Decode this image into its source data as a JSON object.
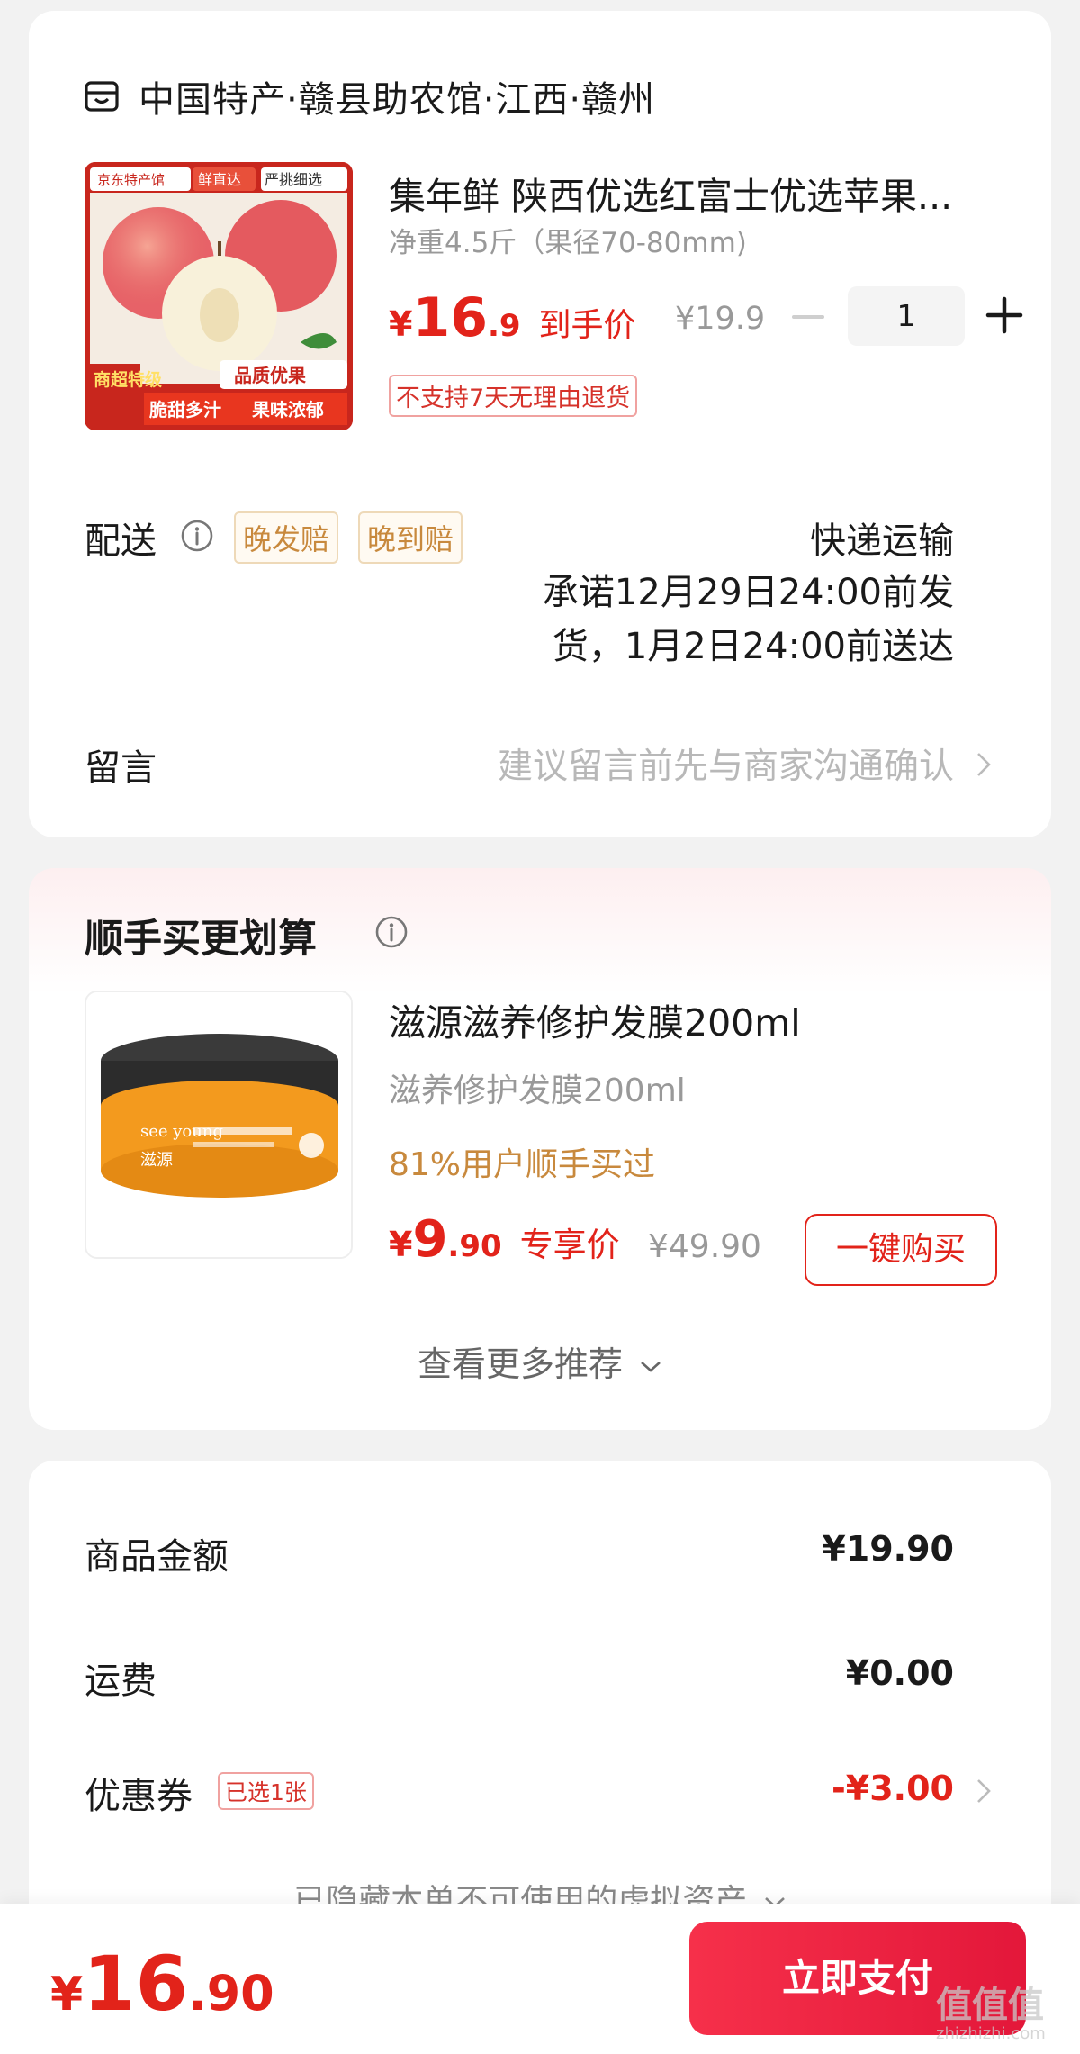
{
  "store": {
    "name": "中国特产·赣县助农馆·江西·赣州",
    "icon": "store-icon"
  },
  "product": {
    "title": "集年鲜 陕西优选红富士优选苹果...",
    "spec": "净重4.5斤（果径70-80mm)",
    "price_currency": "¥",
    "price_int": "16",
    "price_dec": ".9",
    "price_tag": "到手价",
    "orig_price": "¥19.9",
    "quantity": "1",
    "return_policy": "不支持7天无理由退货",
    "image_labels": {
      "brand": "京东特产馆",
      "fresh": "鲜直达",
      "select": "严挑细选",
      "grade": "商超特级",
      "quality": "品质优果",
      "taste1": "脆甜多汁",
      "taste2": "果味浓郁"
    }
  },
  "delivery": {
    "label": "配送",
    "tags": [
      "晚发赔",
      "晚到赔"
    ],
    "method": "快递运输",
    "promise": "承诺12月29日24:00前发货，1月2日24:00前送达"
  },
  "message": {
    "label": "留言",
    "placeholder": "建议留言前先与商家沟通确认"
  },
  "recommend": {
    "title": "顺手买更划算",
    "item": {
      "name": "滋源滋养修护发膜200ml",
      "spec": "滋养修护发膜200ml",
      "bought": "81%用户顺手买过",
      "price_currency": "¥",
      "price_int": "9",
      "price_dec": ".90",
      "price_tag": "专享价",
      "orig_price": "¥49.90",
      "buy_label": "一键购买",
      "jar_text": {
        "brand": "see young",
        "cn": "滋源"
      }
    },
    "more": "查看更多推荐"
  },
  "summary": {
    "goods_label": "商品金额",
    "goods_value": "¥19.90",
    "shipping_label": "运费",
    "shipping_value": "¥0.00",
    "coupon_label": "优惠券",
    "coupon_tag": "已选1张",
    "coupon_value": "-¥3.00",
    "hidden_note": "已隐藏本单不可使用的虚拟资产"
  },
  "footer": {
    "total_currency": "¥",
    "total_int": "16",
    "total_dec": ".90",
    "pay_label": "立即支付",
    "watermark": "值值值",
    "watermark_sub": "zhizhizhi.com"
  },
  "colors": {
    "accent": "#e2231a",
    "tag_gold": "#c8893d",
    "pay_button": "#f6304a"
  }
}
